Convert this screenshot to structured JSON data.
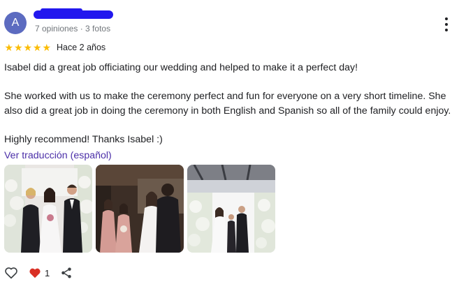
{
  "reviewer": {
    "avatar_initial": "A",
    "meta": "7 opiniones · 3 fotos"
  },
  "rating": {
    "stars": 5,
    "max": 5,
    "when": "Hace 2 años"
  },
  "review": {
    "paragraphs": [
      "Isabel did a great job officiating our wedding and helped to make it a perfect day!",
      "She worked with us to make the ceremony perfect and fun for everyone on a very short timeline. She also did a great job in doing the ceremony in both English and Spanish so all of the family could enjoy.",
      "Highly recommend! Thanks Isabel :)"
    ]
  },
  "translate_link": "Ver traducción (español)",
  "photos": [
    "wedding-photo-1",
    "wedding-photo-2",
    "wedding-photo-3"
  ],
  "actions": {
    "like_count": "1"
  },
  "colors": {
    "avatar": "#5c6bc0",
    "star": "#fbbc04",
    "link": "#4b2fa8",
    "heart": "#d93025",
    "redaction": "#2218ee"
  },
  "icons": [
    "more-vert-icon",
    "star-icon",
    "heart-outline-icon",
    "heart-filled-icon",
    "share-icon"
  ]
}
